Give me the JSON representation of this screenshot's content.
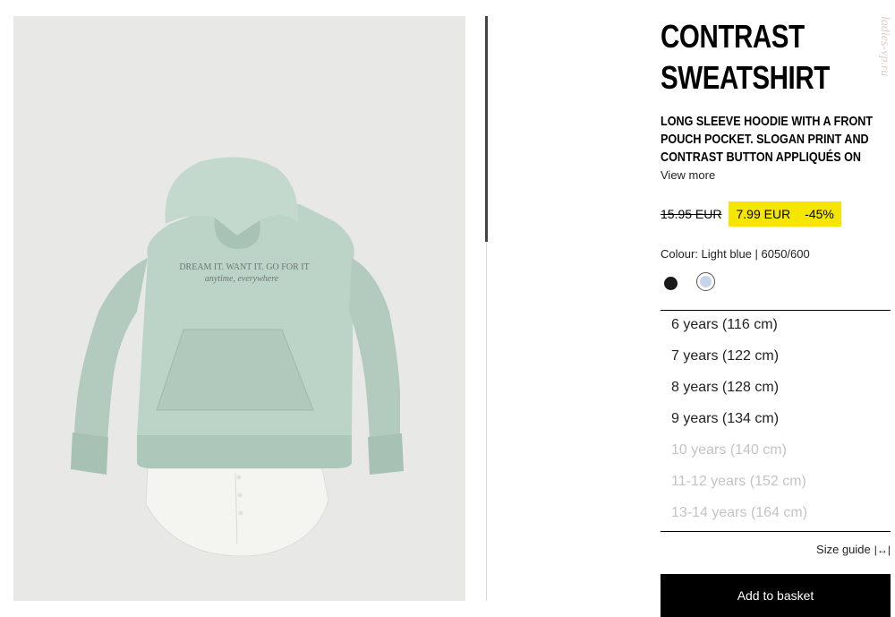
{
  "product": {
    "title_line1": "CONTRAST",
    "title_line2": "SWEATSHIRT",
    "description": "LONG SLEEVE HOODIE WITH A FRONT POUCH POCKET. SLOGAN PRINT AND CONTRAST BUTTON APPLIQUÉS ON THE",
    "view_more": "View more"
  },
  "price": {
    "original": "15.95 EUR",
    "sale": "7.99 EUR",
    "discount": "-45%",
    "highlight_color": "#f5e600"
  },
  "colour": {
    "label": "Colour: Light blue | 6050/600",
    "swatches": [
      {
        "name": "Black",
        "color": "#1a1a1a",
        "selected": false
      },
      {
        "name": "Light blue",
        "color": "#c5d3ec",
        "selected": true
      }
    ]
  },
  "sizes": [
    {
      "label": "6 years (116 cm)",
      "available": true
    },
    {
      "label": "7 years (122 cm)",
      "available": true
    },
    {
      "label": "8 years (128 cm)",
      "available": true
    },
    {
      "label": "9 years (134 cm)",
      "available": true
    },
    {
      "label": "10 years (140 cm)",
      "available": false
    },
    {
      "label": "11-12 years (152 cm)",
      "available": false
    },
    {
      "label": "13-14 years (164 cm)",
      "available": false
    }
  ],
  "size_guide": {
    "label": "Size guide",
    "icon": "ruler-arrows-icon"
  },
  "add_to_basket": "Add to basket",
  "image": {
    "print_line1": "DREAM IT. WANT IT. GO FOR IT",
    "print_line2": "anytime, everywhere",
    "garment_color": "#bcd3c8"
  },
  "watermark": "ladies-vp.ru"
}
